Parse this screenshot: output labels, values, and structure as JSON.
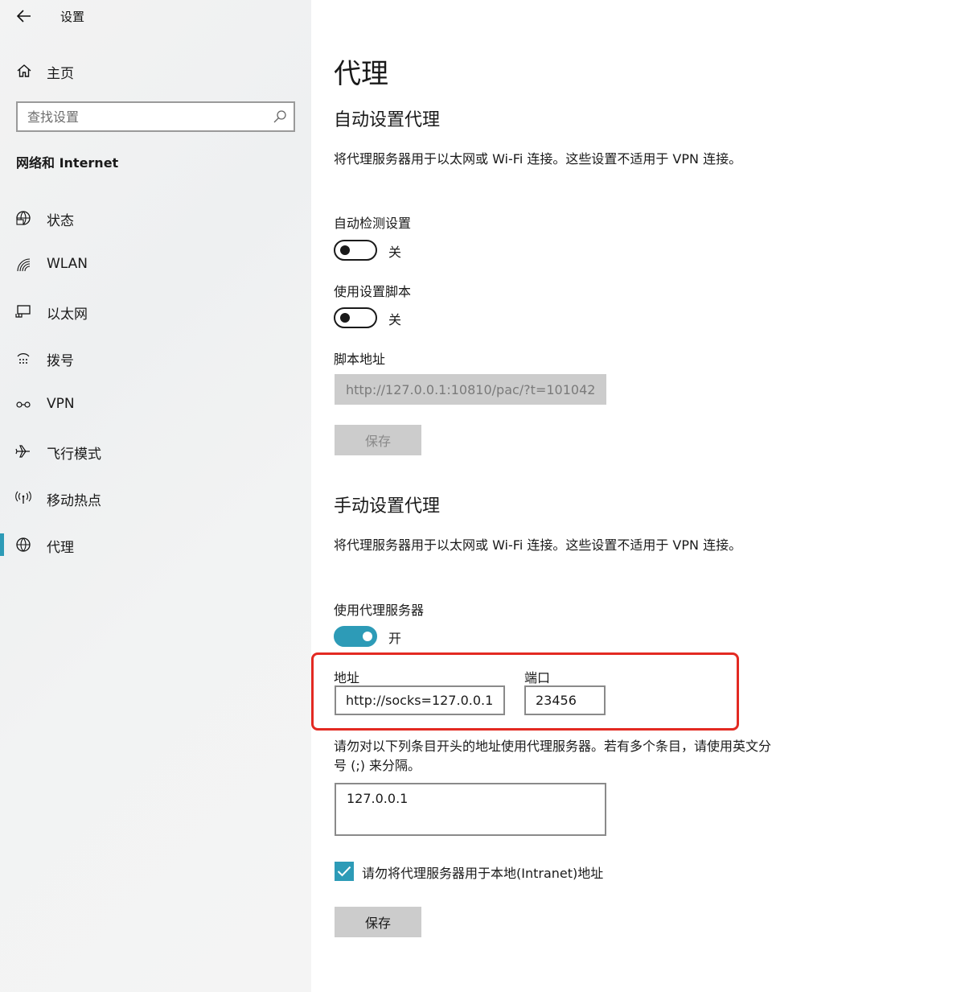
{
  "app": {
    "title": "设置",
    "home_label": "主页",
    "search_placeholder": "查找设置",
    "category": "网络和 Internet"
  },
  "nav": {
    "items": [
      {
        "label": "状态",
        "icon": "globe-status-icon"
      },
      {
        "label": "WLAN",
        "icon": "wifi-icon"
      },
      {
        "label": "以太网",
        "icon": "ethernet-icon"
      },
      {
        "label": "拨号",
        "icon": "dialup-icon"
      },
      {
        "label": "VPN",
        "icon": "vpn-icon"
      },
      {
        "label": "飞行模式",
        "icon": "airplane-icon"
      },
      {
        "label": "移动热点",
        "icon": "hotspot-icon"
      },
      {
        "label": "代理",
        "icon": "globe-icon"
      }
    ],
    "active": "代理"
  },
  "main": {
    "page_title": "代理",
    "auto": {
      "heading": "自动设置代理",
      "description": "将代理服务器用于以太网或 Wi-Fi 连接。这些设置不适用于 VPN 连接。",
      "detect_label": "自动检测设置",
      "detect_state": "关",
      "detect_on": false,
      "script_label": "使用设置脚本",
      "script_state": "关",
      "script_on": false,
      "script_address_label": "脚本地址",
      "script_address_value": "http://127.0.0.1:10810/pac/?t=101042",
      "save_label": "保存"
    },
    "manual": {
      "heading": "手动设置代理",
      "description": "将代理服务器用于以太网或 Wi-Fi 连接。这些设置不适用于 VPN 连接。",
      "use_proxy_label": "使用代理服务器",
      "use_proxy_state": "开",
      "use_proxy_on": true,
      "address_label": "地址",
      "address_value": "http://socks=127.0.0.1",
      "port_label": "端口",
      "port_value": "23456",
      "exceptions_description": "请勿对以下列条目开头的地址使用代理服务器。若有多个条目，请使用英文分号 (;) 来分隔。",
      "exceptions_value": "127.0.0.1",
      "bypass_local_label": "请勿将代理服务器用于本地(Intranet)地址",
      "bypass_local_checked": true,
      "save_label": "保存"
    }
  },
  "colors": {
    "accent": "#2d9bb7",
    "highlight": "#e32a22",
    "sidebar_bg": "#f2f2f2",
    "button_bg": "#cccccc"
  }
}
